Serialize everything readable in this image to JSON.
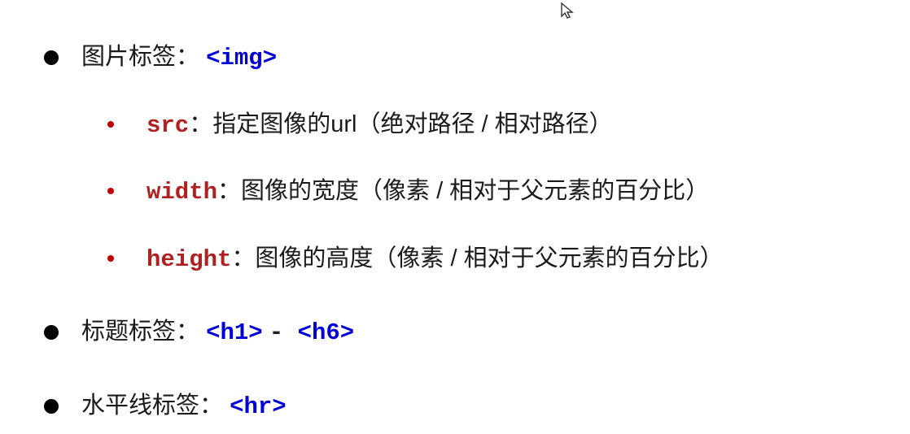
{
  "cursor_glyph": "↖",
  "items": [
    {
      "label": "图片标签：",
      "tags": [
        "<img>"
      ],
      "sep": "",
      "attrs": [
        {
          "name": "src",
          "desc": "：指定图像的url（绝对路径 / 相对路径）"
        },
        {
          "name": "width",
          "desc": "：图像的宽度（像素 / 相对于父元素的百分比）"
        },
        {
          "name": "height",
          "desc": "：图像的高度（像素 / 相对于父元素的百分比）"
        }
      ]
    },
    {
      "label": "标题标签：",
      "tags": [
        "<h1>",
        "<h6>"
      ],
      "sep": " - ",
      "attrs": []
    },
    {
      "label": "水平线标签：",
      "tags": [
        "<hr>"
      ],
      "sep": "",
      "attrs": []
    }
  ]
}
